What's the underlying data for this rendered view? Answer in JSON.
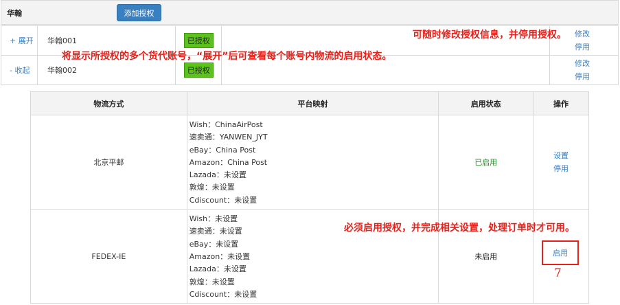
{
  "header": {
    "title": "华翰",
    "add_button": "添加授权"
  },
  "accounts": [
    {
      "toggle": "+ 展开",
      "name": "华翰001",
      "badge": "已授权",
      "ops": [
        "修改",
        "停用"
      ]
    },
    {
      "toggle": "- 收起",
      "name": "华翰002",
      "badge": "已授权",
      "ops": [
        "修改",
        "停用"
      ]
    }
  ],
  "logistics": {
    "headers": [
      "物流方式",
      "平台映射",
      "启用状态",
      "操作"
    ],
    "rows": [
      {
        "method": "北京平邮",
        "mappings": [
          "Wish：ChinaAirPost",
          "速卖通：YANWEN_JYT",
          "eBay：China Post",
          "Amazon：China Post",
          "Lazada：未设置",
          "敦煌：未设置",
          "Cdiscount：未设置"
        ],
        "status": "已启用",
        "ops": [
          "设置",
          "停用"
        ]
      },
      {
        "method": "FEDEX-IE",
        "mappings": [
          "Wish：未设置",
          "速卖通：未设置",
          "eBay：未设置",
          "Amazon：未设置",
          "Lazada：未设置",
          "敦煌：未设置",
          "Cdiscount：未设置"
        ],
        "status": "未启用",
        "ops": [
          "启用"
        ]
      }
    ]
  },
  "annotations": {
    "modify": "可随时修改授权信息，并停用授权。",
    "expand": "将显示所授权的多个货代账号，“展开”后可查看每个账号内物流的启用状态。",
    "enable": "必须启用授权，并完成相关设置，处理订单时才可用。",
    "step": "7"
  },
  "colors": {
    "accent": "#3a7fc0",
    "badge_green": "#5cc21c",
    "annotation_red": "#e8201a",
    "enabled_green": "#1e8a1e"
  }
}
